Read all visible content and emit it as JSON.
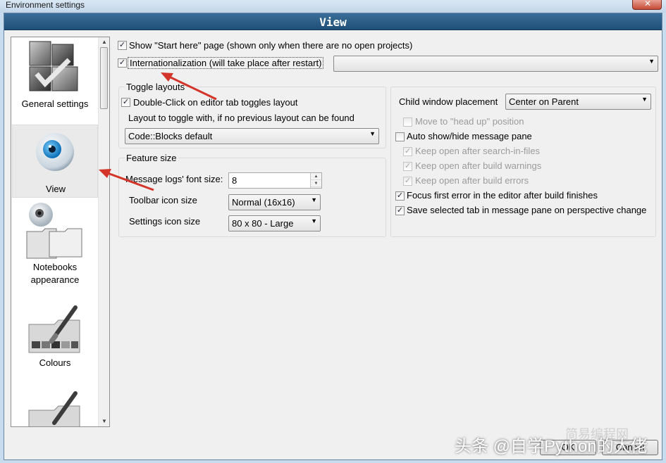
{
  "window": {
    "title": "Environment settings",
    "close_glyph": "✕"
  },
  "header": {
    "title": "View"
  },
  "sidebar": {
    "items": [
      {
        "label": "General settings",
        "icon": "general-settings-icon"
      },
      {
        "label": "View",
        "icon": "eye-icon",
        "selected": true
      },
      {
        "label_line1": "Notebooks",
        "label_line2": "appearance",
        "icon": "notebooks-icon"
      },
      {
        "label": "Colours",
        "icon": "colours-palette-icon"
      },
      {
        "label": "",
        "icon": "palette-icon"
      }
    ]
  },
  "top": {
    "show_start_here": {
      "label": "Show \"Start here\" page (shown only when there are no open projects)",
      "checked": true
    },
    "internationalization": {
      "label": "Internationalization (will take place after restart)",
      "checked": true,
      "combo_value": ""
    }
  },
  "toggle_layouts": {
    "title": "Toggle layouts",
    "double_click": {
      "label": "Double-Click on editor tab toggles layout",
      "checked": true
    },
    "layout_label": "Layout to toggle with, if no previous layout can be found",
    "layout_value": "Code::Blocks default"
  },
  "feature_size": {
    "title": "Feature size",
    "font_size_label": "Message logs' font size:",
    "font_size_value": "8",
    "toolbar_icon_label": "Toolbar icon size",
    "toolbar_icon_value": "Normal (16x16)",
    "settings_icon_label": "Settings icon size",
    "settings_icon_value": "80 x 80 - Large"
  },
  "right_panel": {
    "child_window_label": "Child window placement",
    "child_window_value": "Center on Parent",
    "move_head_up": {
      "label": "Move to \"head up\" position",
      "checked": false,
      "disabled": true
    },
    "auto_show_hide": {
      "label": "Auto show/hide message pane",
      "checked": false
    },
    "keep_search": {
      "label": "Keep open after search-in-files",
      "checked": true,
      "disabled": true
    },
    "keep_warnings": {
      "label": "Keep open after build warnings",
      "checked": true,
      "disabled": true
    },
    "keep_errors": {
      "label": "Keep open after build errors",
      "checked": true,
      "disabled": true
    },
    "focus_first_error": {
      "label": "Focus first error in the editor after build finishes",
      "checked": true
    },
    "save_selected_tab": {
      "label": "Save selected tab in message pane on perspective change",
      "checked": true
    }
  },
  "buttons": {
    "ok": "OK",
    "cancel": "Cancel"
  },
  "overlay": {
    "watermark": "头条 @自学Python的大佬",
    "watermark2": "简易编程网"
  },
  "colors": {
    "header_bg": "#2b5f8a",
    "annotation_arrow": "#d3352a",
    "titlebar": "#c7dcef"
  }
}
